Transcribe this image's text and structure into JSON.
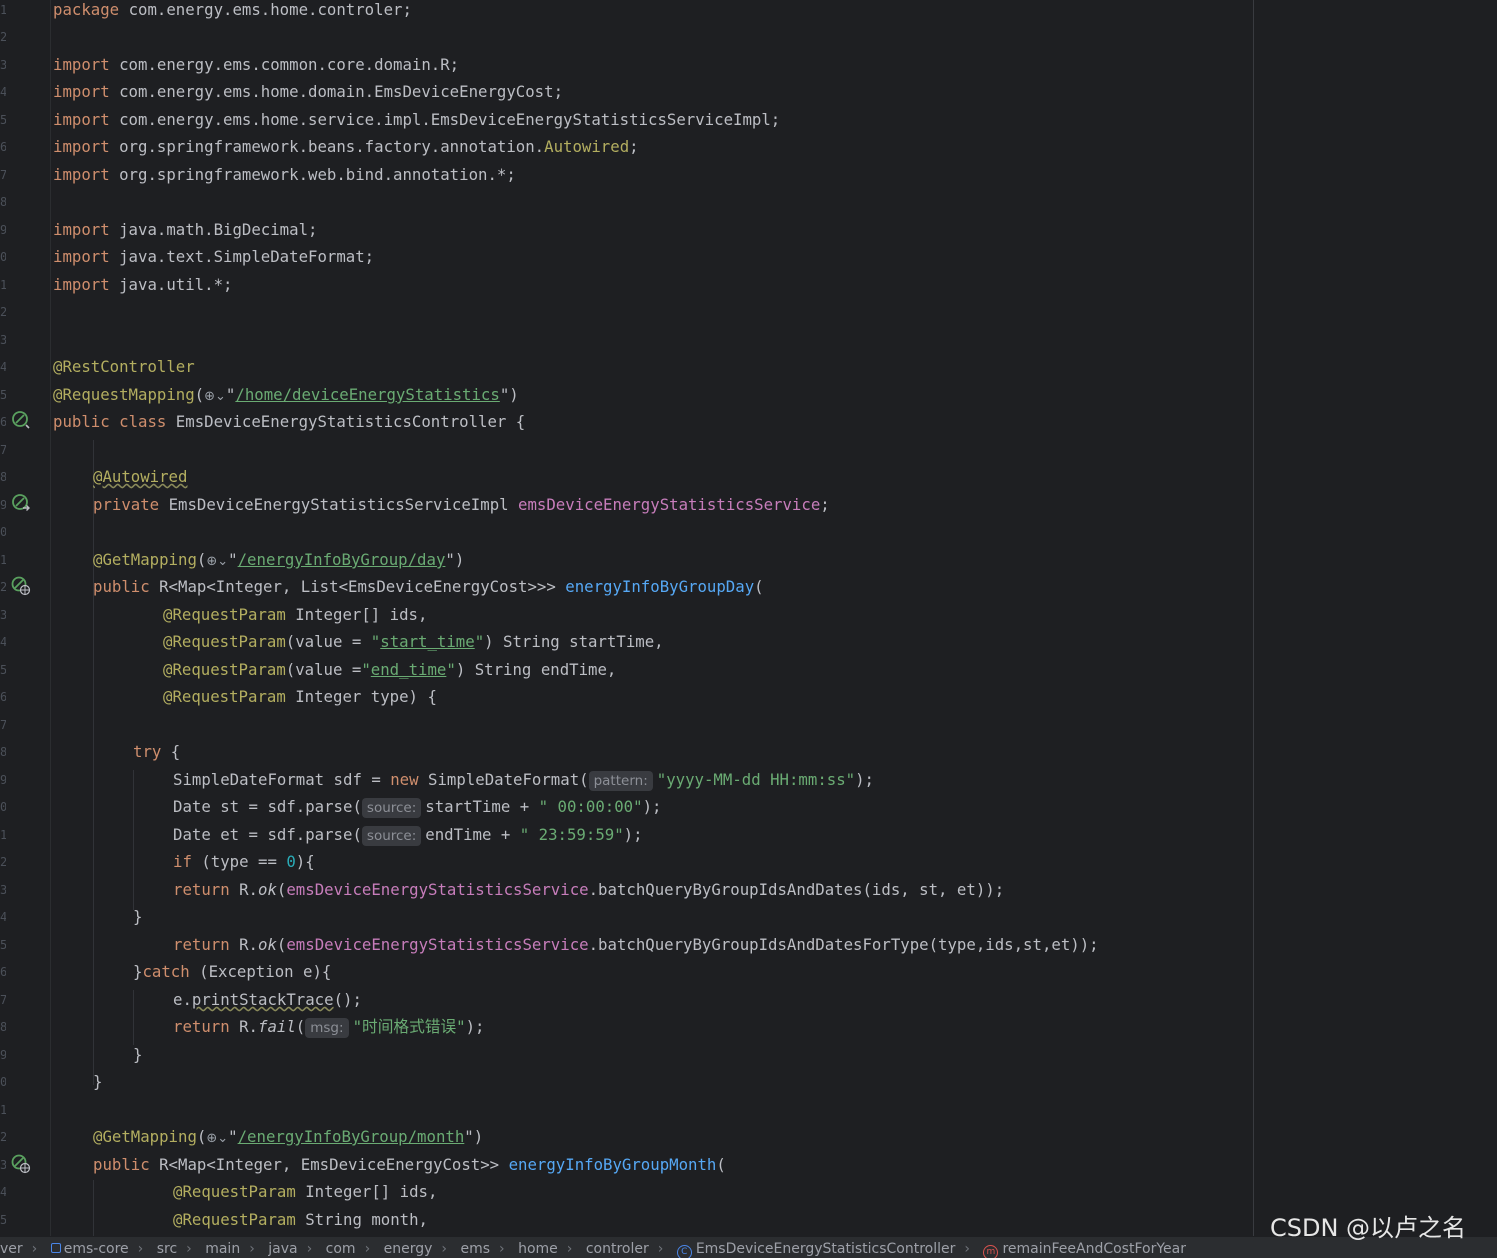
{
  "editor": {
    "code": {
      "package_kw": "package",
      "package_name": " com.energy.ems.home.controler;",
      "import_kw": "import",
      "imports": [
        " com.energy.ems.common.core.domain.R;",
        " com.energy.ems.home.domain.EmsDeviceEnergyCost;",
        " com.energy.ems.home.service.impl.EmsDeviceEnergyStatisticsServiceImpl;",
        " org.springframework.beans.factory.annotation.",
        " org.springframework.web.bind.annotation.*;",
        " java.math.BigDecimal;",
        " java.text.SimpleDateFormat;",
        " java.util.*;"
      ],
      "autowired_import": "Autowired",
      "rest_controller": "@RestController",
      "request_mapping": "@RequestMapping",
      "request_mapping_path": "/home/deviceEnergyStatistics",
      "public_kw": "public",
      "class_kw": "class",
      "private_kw": "private",
      "class_decl": " EmsDeviceEnergyStatisticsController {",
      "autowired_ann": "@Autowired",
      "service_type": " EmsDeviceEnergyStatisticsServiceImpl ",
      "service_field": "emsDeviceEnergyStatisticsService",
      "get_mapping": "@GetMapping",
      "day_path": "/energyInfoByGroup/day",
      "day_return": " R<Map<Integer, List<EmsDeviceEnergyCost>>> ",
      "day_method": "energyInfoByGroupDay",
      "request_param": "@RequestParam",
      "ids_param": " Integer[] ids,",
      "value_eq": "(value = ",
      "value_eq2": "(value =",
      "start_time_key": "start_time",
      "start_time_param": ") String startTime,",
      "end_time_key": "end_time",
      "end_time_param": ") String endTime,",
      "type_param": " Integer type) {",
      "try_kw": "try",
      "new_kw": "new",
      "if_kw": "if",
      "return_kw": "return",
      "catch_kw": "catch",
      "sdf_decl": "SimpleDateFormat sdf = ",
      "sdf_ctor": " SimpleDateFormat(",
      "hint_pattern": "pattern:",
      "pattern_value": "yyyy-MM-dd HH:mm:ss",
      "st_decl": "Date st = sdf.parse(",
      "hint_source": "source:",
      "st_arg": "startTime + ",
      "st_suffix": " 00:00:00",
      "et_decl": "Date et = sdf.parse(",
      "et_arg": "endTime + ",
      "et_suffix": " 23:59:59",
      "if_cond": " (type == ",
      "zero": "0",
      "r_dot": " R.",
      "ok": "ok",
      "fail": "fail",
      "batch_call": ".batchQueryByGroupIdsAndDates(ids, st, et));",
      "batch_type_call": ".batchQueryByGroupIdsAndDatesForType(type,ids,st,et));",
      "catch_args": " (Exception e){",
      "print_stack": "printStackTrace",
      "hint_msg": "msg:",
      "fail_msg": "时间格式错误",
      "month_path": "/energyInfoByGroup/month",
      "month_return": " R<Map<Integer, EmsDeviceEnergyCost>> ",
      "month_method": "energyInfoByGroupMonth",
      "month_param": " String month,"
    }
  },
  "breadcrumb": {
    "items": [
      "ver",
      "ems-core",
      "src",
      "main",
      "java",
      "com",
      "energy",
      "ems",
      "home",
      "controler",
      "EmsDeviceEnergyStatisticsController",
      "remainFeeAndCostForYear"
    ]
  },
  "watermark": "CSDN @以卢之名",
  "colors": {
    "background": "#1e1f22",
    "keyword": "#cf8e6d",
    "annotation": "#b3ae60",
    "string": "#6aab73",
    "field": "#c77dbb",
    "method": "#56a8f5"
  },
  "icons": [
    "bean-icon",
    "autowired-bean-icon",
    "web-endpoint-icon",
    "globe-icon",
    "class-icon",
    "method-icon"
  ]
}
